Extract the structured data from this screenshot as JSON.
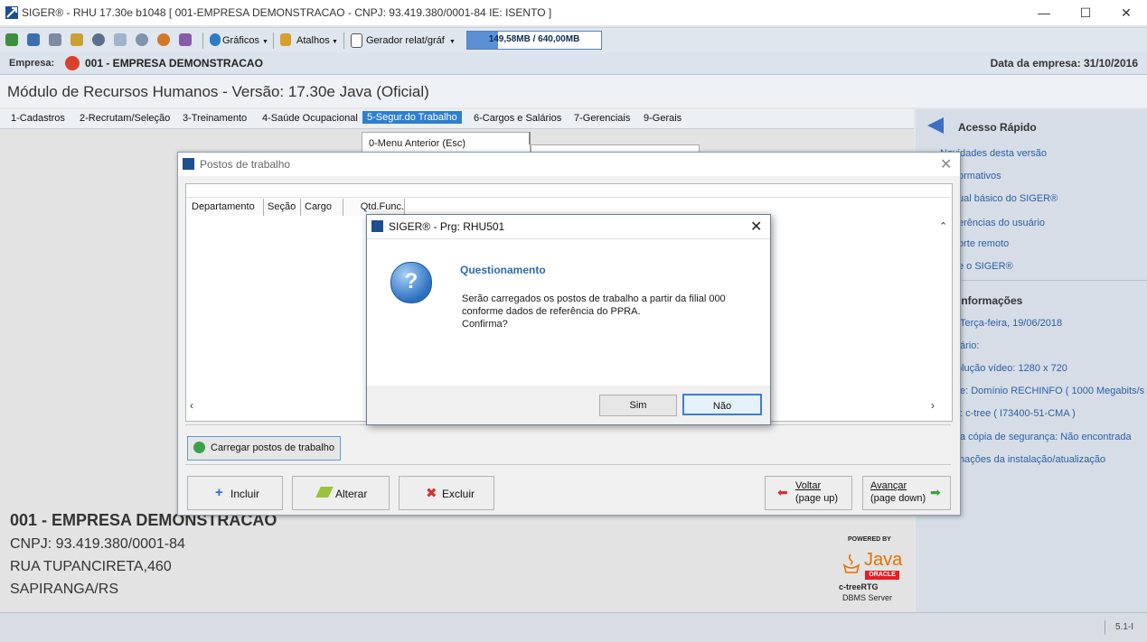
{
  "titlebar": {
    "title": "SIGER® - RHU 17.30e b1048 [ 001-EMPRESA DEMONSTRACAO - CNPJ: 93.419.380/0001-84 IE: ISENTO ]",
    "minimize": "—",
    "maximize": "☐",
    "close": "✕"
  },
  "toolbar": {
    "graficos": "Gráficos",
    "atalhos": "Atalhos",
    "gerador": "Gerador relat/gráf",
    "memory": "149,58MB / 640,00MB",
    "memory_used_fraction": 0.23
  },
  "empresa_bar": {
    "label": "Empresa:",
    "value": "001 - EMPRESA DEMONSTRACAO",
    "date": "Data da empresa: 31/10/2016"
  },
  "module_title": "Módulo de Recursos Humanos - Versão: 17.30e Java (Oficial)",
  "menu": [
    "1-Cadastros",
    "2-Recrutam/Seleção",
    "3-Treinamento",
    "4-Saúde Ocupacional",
    "5-Segur.do Trabalho",
    "6-Cargos e Salários",
    "7-Gerenciais",
    "9-Gerais"
  ],
  "dropdown": {
    "item0": "0-Menu Anterior (Esc)"
  },
  "right_panel": {
    "quick_title": "Acesso Rápido",
    "links": [
      "Novidades desta versão",
      "ormativos",
      "ual básico do SIGER®",
      "erências do usuário",
      "orte remoto",
      "e o SIGER®"
    ],
    "info_title": "Informações",
    "info": [
      "Terça-feira, 19/06/2018",
      "ário:",
      "olução vídeo:  1280 x 720",
      "e: Domínio RECHINFO ( 1000 Megabits/s )",
      ": c-tree ( I73400-51-CMA )",
      "a cópia de segurança:  Não encontrada",
      "mações da instalação/atualização"
    ]
  },
  "company_info": {
    "name": "001 - EMPRESA DEMONSTRACAO",
    "cnpj": "CNPJ: 93.419.380/0001-84",
    "address": "RUA TUPANCIRETA,460",
    "city": "SAPIRANGA/RS"
  },
  "powered": {
    "by": "POWERED BY",
    "java": "Java",
    "oracle": "ORACLE",
    "ctree": "c-treeRTG",
    "dbms": "DBMS Server"
  },
  "status": {
    "version": "5.1-I"
  },
  "postos_window": {
    "title": "Postos de trabalho",
    "columns": [
      "Departamento",
      "Seção",
      "Cargo",
      "Qtd.Func."
    ],
    "load_button": "Carregar postos de trabalho",
    "incluir": "Incluir",
    "alterar": "Alterar",
    "excluir": "Excluir",
    "voltar_1": "Voltar",
    "voltar_2": "(page up)",
    "avancar_1": "Avançar",
    "avancar_2": "(page down)"
  },
  "dialog": {
    "title": "SIGER® - Prg: RHU501",
    "heading": "Questionamento",
    "line1": "Serão carregados os postos de trabalho a partir da filial 000",
    "line2": "conforme dados de referência do PPRA.",
    "line3": "Confirma?",
    "yes": "Sim",
    "no": "Não"
  }
}
